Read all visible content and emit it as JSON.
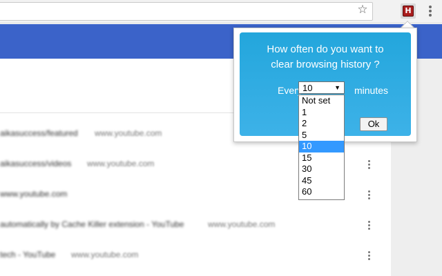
{
  "browser": {
    "star_icon": "star-outline-icon",
    "extension_badge": "H",
    "menu_icon": "kebab-icon"
  },
  "history": {
    "rows": [
      {
        "title": "aikasuccess/featured",
        "domain": "www.youtube.com"
      },
      {
        "title": "aikasuccess/videos",
        "domain": "www.youtube.com"
      },
      {
        "title": "www.youtube.com",
        "domain": ""
      },
      {
        "title": "automatically by Cache Killer extension - YouTube",
        "domain": "www.youtube.com"
      },
      {
        "title": "tech - YouTube",
        "domain": "www.youtube.com"
      }
    ]
  },
  "popup": {
    "title_line1": "How often do you want to",
    "title_line2": "clear browsing history ?",
    "every_label": "Every",
    "minutes_label": "minutes",
    "ok_label": "Ok",
    "selected_value": "10",
    "options": [
      "Not set",
      "1",
      "2",
      "5",
      "10",
      "15",
      "30",
      "45",
      "60"
    ],
    "selected_index": 4,
    "gradient_color": "#23a6dc",
    "highlight_color": "#3399ff"
  }
}
